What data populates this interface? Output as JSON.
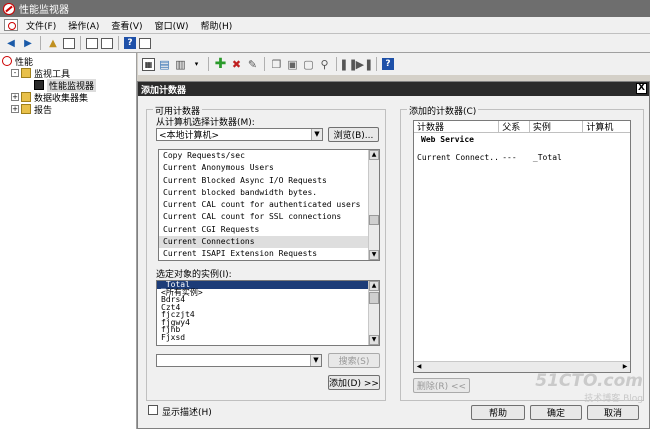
{
  "window": {
    "title": "性能监视器"
  },
  "menu": [
    "文件(F)",
    "操作(A)",
    "查看(V)",
    "窗口(W)",
    "帮助(H)"
  ],
  "tree": [
    {
      "label": "性能",
      "level": 0,
      "icon": "performance-icon"
    },
    {
      "label": "监视工具",
      "level": 1,
      "icon": "folder-icon",
      "expander": "-"
    },
    {
      "label": "性能监视器",
      "level": 2,
      "icon": "monitor-icon",
      "selected": true
    },
    {
      "label": "数据收集器集",
      "level": 1,
      "icon": "folder-icon",
      "expander": "+"
    },
    {
      "label": "报告",
      "level": 1,
      "icon": "folder-icon",
      "expander": "+"
    }
  ],
  "dialog": {
    "title": "添加计数器",
    "close": "X",
    "available_group": "可用计数器",
    "select_from": "从计算机选择计数器(M):",
    "computer_value": "<本地计算机>",
    "browse_label": "浏览(B)...",
    "counters": [
      "Copy Requests/sec",
      "Current Anonymous Users",
      "Current Blocked Async I/O Requests",
      "Current blocked bandwidth bytes.",
      "Current CAL count for authenticated users",
      "Current CAL count for SSL connections",
      "Current CGI Requests",
      "Current Connections",
      "Current ISAPI Extension Requests"
    ],
    "counters_highlight_index": 7,
    "instances_label": "选定对象的实例(I):",
    "instances": [
      "_Total",
      "<所有实例>",
      "Bdrs4",
      "Czt4",
      "fjczjt4",
      "fjgwy4",
      "fjhb",
      "Fjxsd"
    ],
    "instances_selected_index": 0,
    "search_value": "",
    "search_label": "搜索(S)",
    "add_label": "添加(D) >>",
    "added_group": "添加的计数器(C)",
    "added_columns": [
      "计数器",
      "父系",
      "实例",
      "计算机"
    ],
    "added_object": "Web Service",
    "added_rows": [
      {
        "counter": "Current Connect...",
        "parent": "---",
        "instance": "_Total",
        "computer": ""
      }
    ],
    "remove_label": "删除(R) <<",
    "show_desc_label": "显示描述(H)",
    "help_label": "帮助",
    "ok_label": "确定",
    "cancel_label": "取消"
  },
  "watermark": {
    "line1": "51CTO.com",
    "line2": "技术博客 Blog"
  }
}
